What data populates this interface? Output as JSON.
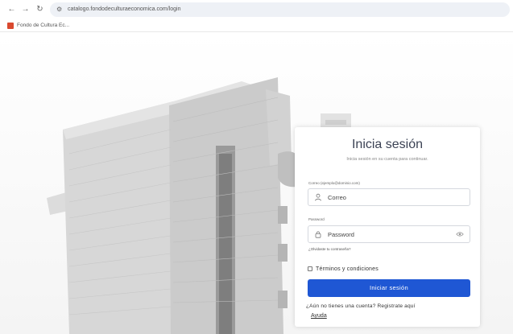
{
  "browser": {
    "url": "catalogo.fondodeculturaeconomica.com/login",
    "bookmark_label": "Fondo de Cultura Ec..."
  },
  "login": {
    "title": "Inicia sesión",
    "subtitle": "Inicia sesión en su cuenta para continuar.",
    "email_label": "Correo (ejemplo@dominio.com)",
    "email_placeholder": "Correo",
    "password_label": "Password",
    "password_placeholder": "Password",
    "forgot_password": "¿Olvidaste tu contraseña?",
    "terms_label": "Términos y condiciones",
    "submit_label": "Iniciar sesión",
    "register_text": "¿Aún no tienes una cuenta? Registrate aquí",
    "help_link": "Ayuda"
  },
  "colors": {
    "primary_button": "#1f57d4",
    "bookmark_favicon": "#d9492f"
  }
}
